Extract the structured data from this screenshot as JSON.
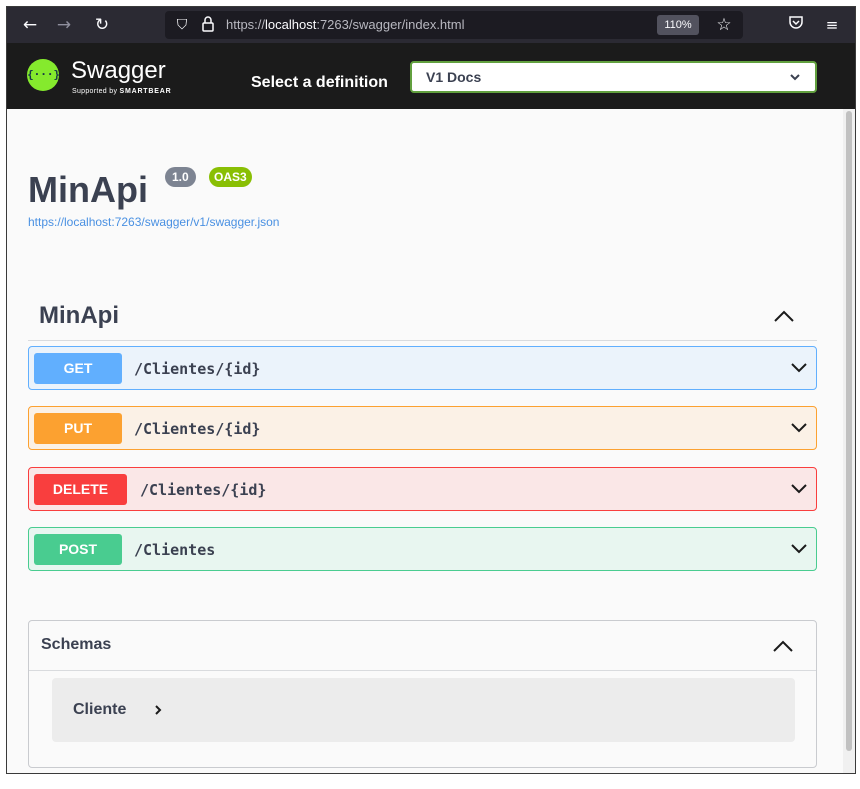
{
  "browser": {
    "back_icon": "arrow-left-icon",
    "forward_icon": "arrow-right-icon",
    "reload_icon": "reload-icon",
    "url_prefix": "https://",
    "url_host": "localhost",
    "url_rest": ":7263/swagger/index.html",
    "zoom": "110%",
    "bookmark_icon": "star-icon",
    "pocket_icon": "pocket-icon",
    "menu_icon": "hamburger-menu-icon"
  },
  "topbar": {
    "logo_text": "Swagger",
    "logo_glyph": "{···}",
    "logo_sub_prefix": "Supported by ",
    "logo_sub_brand": "SMARTBEAR",
    "definition_label": "Select a definition",
    "definition_value": "V1 Docs"
  },
  "info": {
    "title": "MinApi",
    "version": "1.0",
    "oas": "OAS3",
    "spec_url": "https://localhost:7263/swagger/v1/swagger.json"
  },
  "tag": {
    "name": "MinApi"
  },
  "operations": [
    {
      "method": "GET",
      "path": "/Clientes/{id}"
    },
    {
      "method": "PUT",
      "path": "/Clientes/{id}"
    },
    {
      "method": "DELETE",
      "path": "/Clientes/{id}"
    },
    {
      "method": "POST",
      "path": "/Clientes"
    }
  ],
  "schemas": {
    "title": "Schemas",
    "models": [
      {
        "name": "Cliente"
      }
    ]
  },
  "colors": {
    "get": "#61affe",
    "put": "#fca130",
    "delete": "#f93e3e",
    "post": "#49cc90",
    "swagger_green": "#85ea2d",
    "topbar": "#1b1b1b"
  }
}
